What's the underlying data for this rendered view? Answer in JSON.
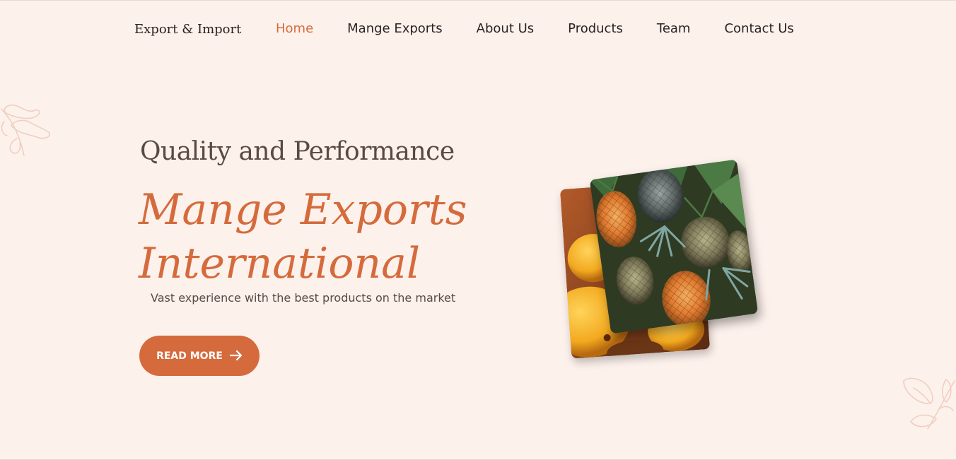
{
  "nav": {
    "brand": "Export & Import",
    "links": [
      {
        "label": "Home",
        "active": true
      },
      {
        "label": "Mange Exports",
        "active": false
      },
      {
        "label": "About Us",
        "active": false
      },
      {
        "label": "Products",
        "active": false
      },
      {
        "label": "Team",
        "active": false
      },
      {
        "label": "Contact Us",
        "active": false
      }
    ]
  },
  "hero": {
    "subtitle": "Quality and Performance",
    "headline_line1": "Mange Exports",
    "headline_line2": "International",
    "tagline": "Vast experience with the best products on the market",
    "cta_label": "READ MORE",
    "cta_icon": "arrow-right-icon"
  },
  "colors": {
    "background": "#fdf1ec",
    "accent": "#d56b3c",
    "text_dark": "#2a2220",
    "text_muted": "#5a4a44"
  }
}
